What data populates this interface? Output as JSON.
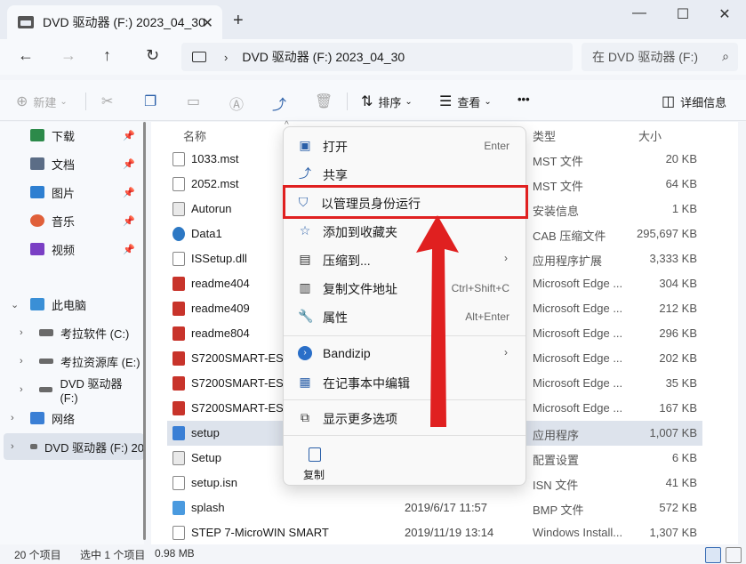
{
  "window": {
    "tab_title": "DVD 驱动器 (F:) 2023_04_30",
    "tab_close": "✕",
    "new_tab": "+",
    "minimize": "—",
    "maximize": "☐",
    "close": "✕"
  },
  "address": {
    "back": "←",
    "forward": "→",
    "up": "↑",
    "refresh": "↻",
    "path": "DVD 驱动器 (F:) 2023_04_30",
    "search_placeholder": "在 DVD 驱动器 (F:)"
  },
  "toolbar": {
    "new_label": "新建",
    "sort_label": "排序",
    "view_label": "查看",
    "more_label": "•••",
    "details_label": "详细信息"
  },
  "sidebar": {
    "quick": [
      {
        "label": "下载",
        "icon": "download-icon"
      },
      {
        "label": "文档",
        "icon": "document-icon"
      },
      {
        "label": "图片",
        "icon": "picture-icon"
      },
      {
        "label": "音乐",
        "icon": "music-icon"
      },
      {
        "label": "视频",
        "icon": "video-icon"
      }
    ],
    "this_pc": "此电脑",
    "drives": [
      "考拉软件 (C:)",
      "考拉资源库 (E:)",
      "DVD 驱动器 (F:)"
    ],
    "network": "网络",
    "selected": "DVD 驱动器 (F:) 20"
  },
  "columns": {
    "name": "名称",
    "type": "类型",
    "size": "大小"
  },
  "files": [
    {
      "name": "1033.mst",
      "date": "",
      "type": "MST 文件",
      "size": "20 KB",
      "icon": "file"
    },
    {
      "name": "2052.mst",
      "date": "",
      "type": "MST 文件",
      "size": "64 KB",
      "icon": "file"
    },
    {
      "name": "Autorun",
      "date": "",
      "type": "安装信息",
      "size": "1 KB",
      "icon": "gear"
    },
    {
      "name": "Data1",
      "date": "",
      "type": "CAB 压缩文件",
      "size": "295,697 KB",
      "icon": "cd"
    },
    {
      "name": "ISSetup.dll",
      "date": "",
      "type": "应用程序扩展",
      "size": "3,333 KB",
      "icon": "file"
    },
    {
      "name": "readme404",
      "date": "",
      "type": "Microsoft Edge ...",
      "size": "304 KB",
      "icon": "pdf"
    },
    {
      "name": "readme409",
      "date": "",
      "type": "Microsoft Edge ...",
      "size": "212 KB",
      "icon": "pdf"
    },
    {
      "name": "readme804",
      "date": "",
      "type": "Microsoft Edge ...",
      "size": "296 KB",
      "icon": "pdf"
    },
    {
      "name": "S7200SMART-ES_",
      "date": "",
      "type": "Microsoft Edge ...",
      "size": "202 KB",
      "icon": "pdf"
    },
    {
      "name": "S7200SMART-ES_",
      "date": "",
      "type": "Microsoft Edge ...",
      "size": "35 KB",
      "icon": "pdf"
    },
    {
      "name": "S7200SMART-ES_",
      "date": "",
      "type": "Microsoft Edge ...",
      "size": "167 KB",
      "icon": "pdf"
    },
    {
      "name": "setup",
      "date": "",
      "type": "应用程序",
      "size": "1,007 KB",
      "icon": "app"
    },
    {
      "name": "Setup",
      "date": "",
      "type": "配置设置",
      "size": "6 KB",
      "icon": "gear"
    },
    {
      "name": "setup.isn",
      "date": "",
      "type": "ISN 文件",
      "size": "41 KB",
      "icon": "file"
    },
    {
      "name": "splash",
      "date": "2019/6/17 11:57",
      "type": "BMP 文件",
      "size": "572 KB",
      "icon": "img"
    },
    {
      "name": "STEP 7-MicroWIN SMART",
      "date": "2019/11/19 13:14",
      "type": "Windows Install...",
      "size": "1,307 KB",
      "icon": "file"
    }
  ],
  "context_menu": {
    "open": "打开",
    "open_short": "Enter",
    "share": "共享",
    "run_as_admin": "以管理员身份运行",
    "add_favorites": "添加到收藏夹",
    "compress": "压缩到...",
    "copy_path": "复制文件地址",
    "copy_path_short": "Ctrl+Shift+C",
    "properties": "属性",
    "properties_short": "Alt+Enter",
    "bandizip": "Bandizip",
    "edit_notepad": "在记事本中编辑",
    "more_options": "显示更多选项",
    "copy": "复制"
  },
  "status": {
    "count": "20 个项目",
    "selected": "选中 1 个项目",
    "size": "0.98 MB"
  },
  "colors": {
    "highlight": "#e02020",
    "accent": "#2a5fa8"
  }
}
